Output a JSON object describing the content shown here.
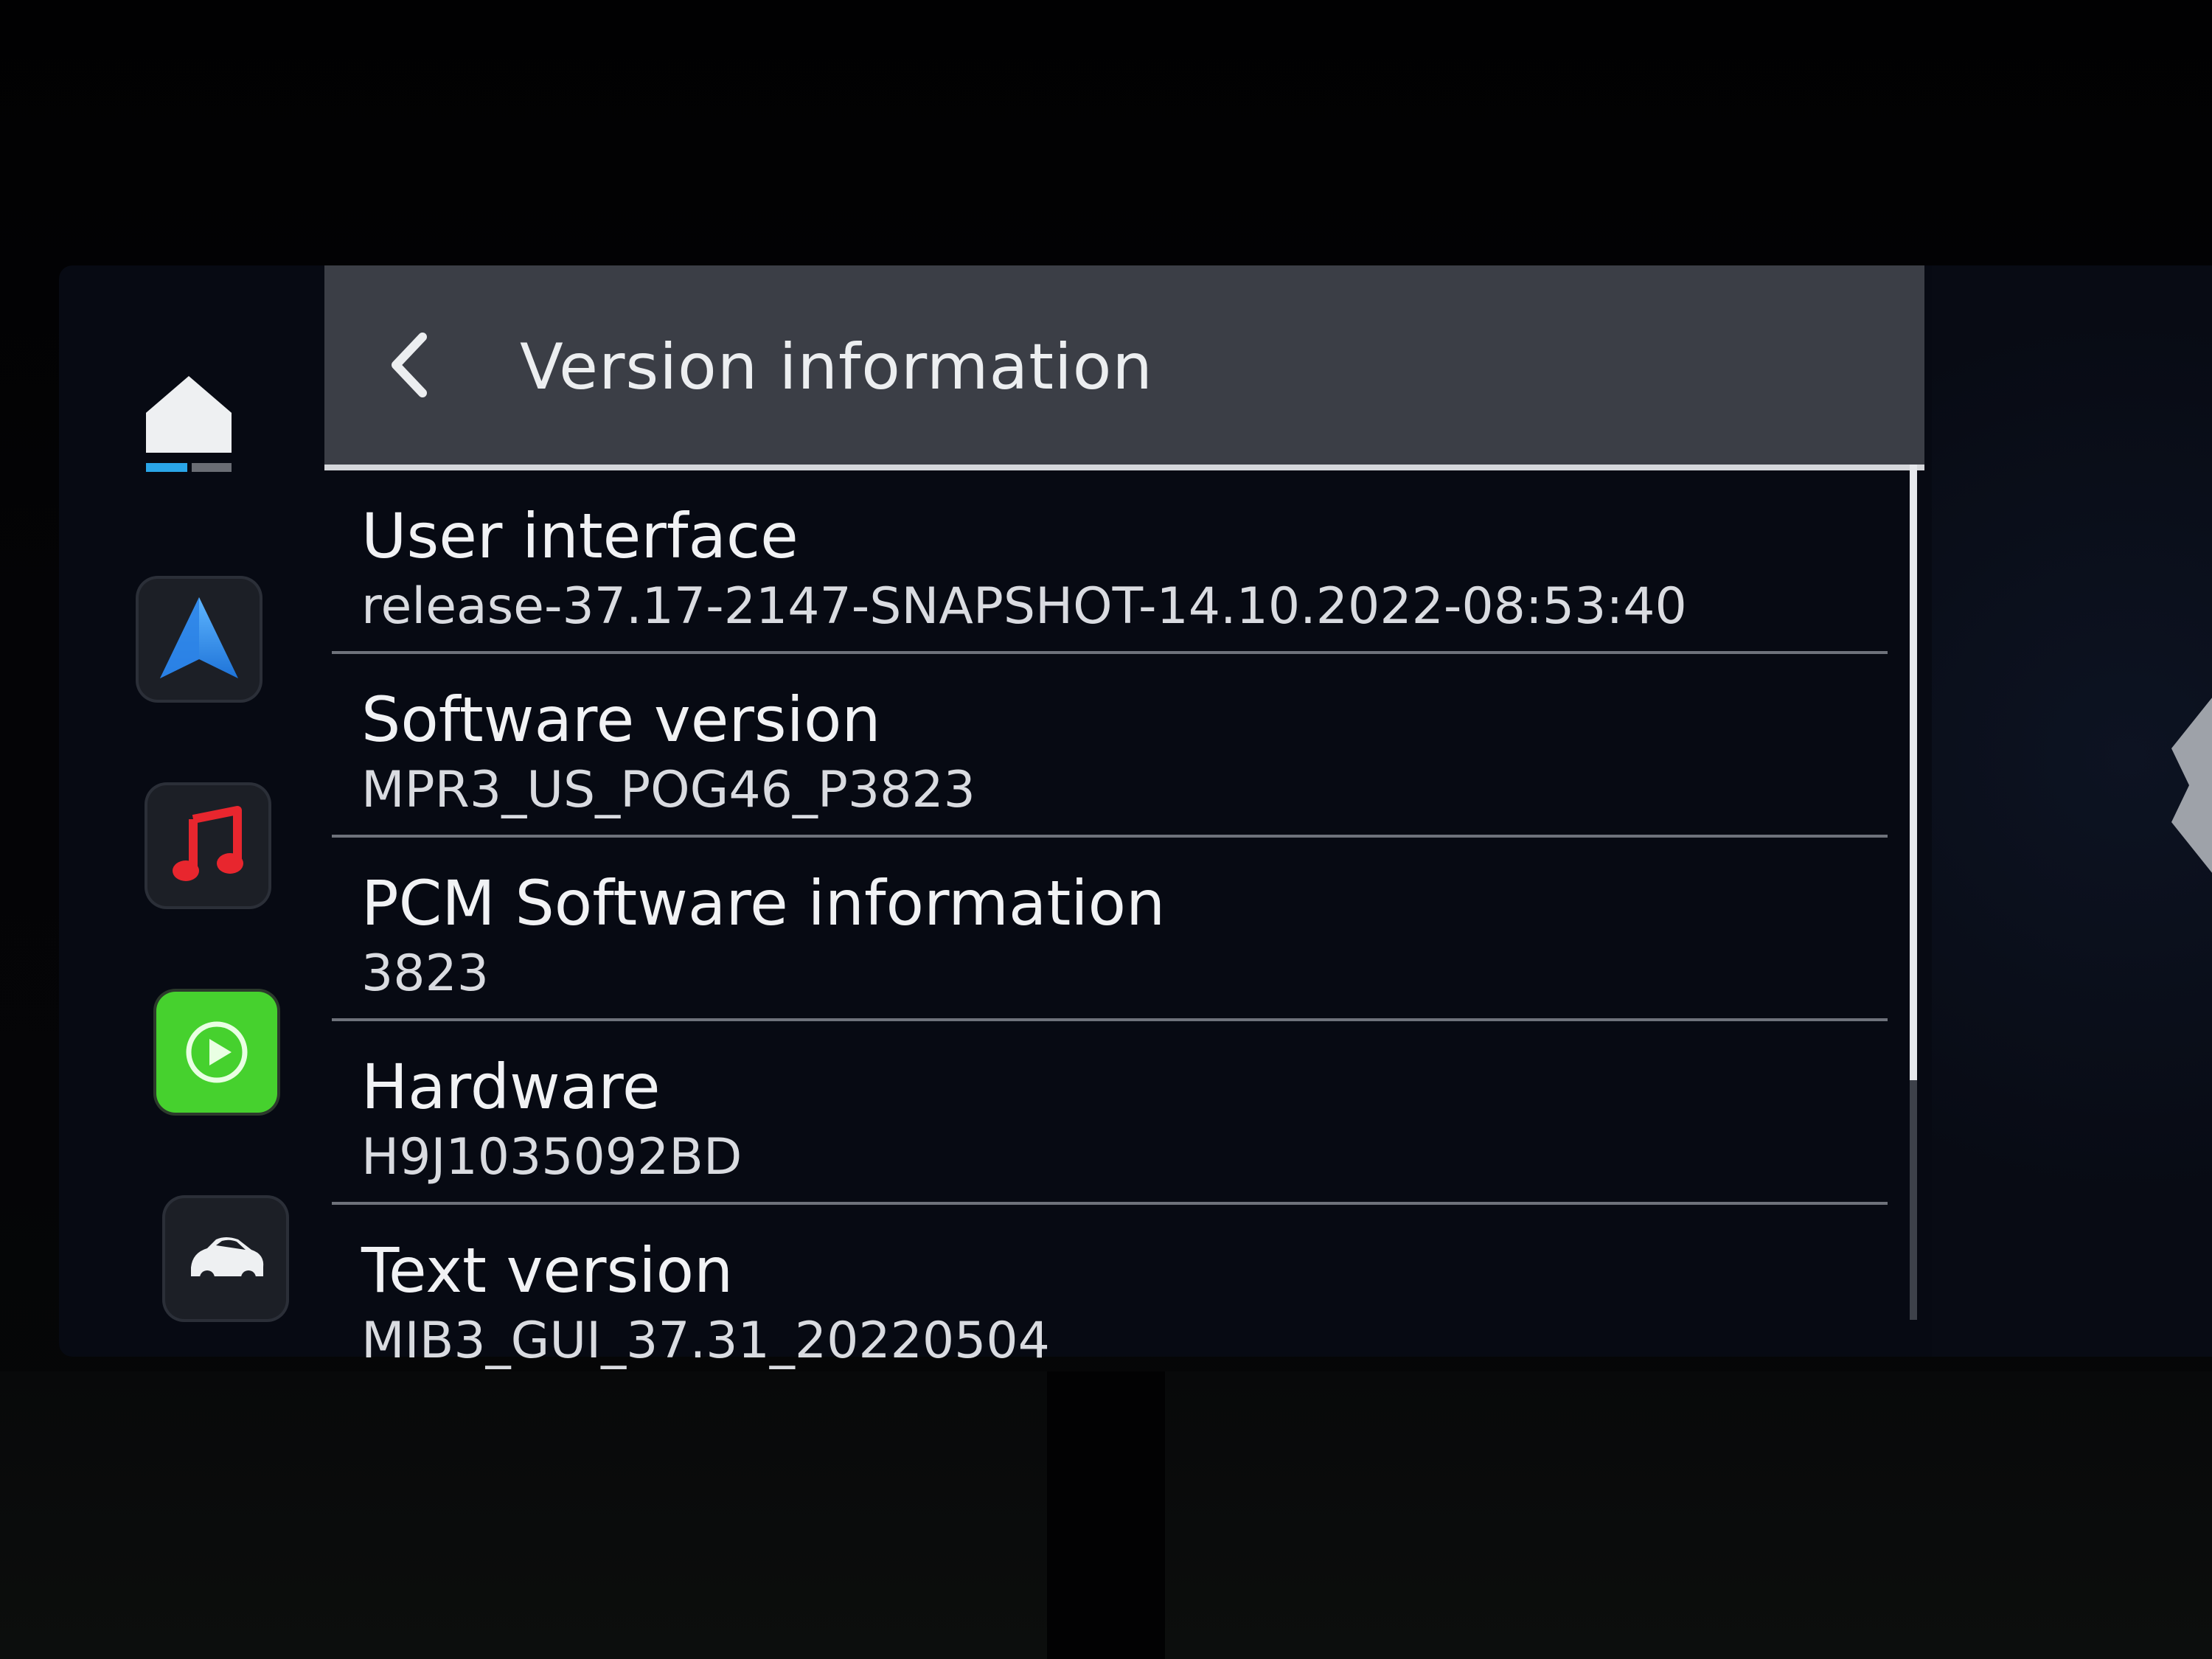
{
  "header": {
    "title": "Version information"
  },
  "rail": {
    "items": [
      {
        "icon": "home-icon"
      },
      {
        "icon": "navigation-arrow-icon"
      },
      {
        "icon": "music-note-icon"
      },
      {
        "icon": "carplay-icon"
      },
      {
        "icon": "car-icon"
      }
    ]
  },
  "version_list": [
    {
      "label": "User interface",
      "value": "release-37.17-2147-SNAPSHOT-14.10.2022-08:53:40"
    },
    {
      "label": "Software version",
      "value": "MPR3_US_POG46_P3823"
    },
    {
      "label": "PCM Software information",
      "value": "3823"
    },
    {
      "label": "Hardware",
      "value": "H9J1035092BD"
    },
    {
      "label": "Text version",
      "value": "MIB3_GUI_37.31_20220504"
    }
  ],
  "colors": {
    "header_bg": "#3b3e46",
    "screen_bg": "#070a13",
    "home_indicator_active": "#2aa6e8",
    "nav_blue": "#2e8fe6",
    "music_red": "#e8262e",
    "carplay_green": "#46d12e",
    "text_primary": "#f1f2f4"
  },
  "scroll": {
    "visible_fraction": 0.72
  }
}
